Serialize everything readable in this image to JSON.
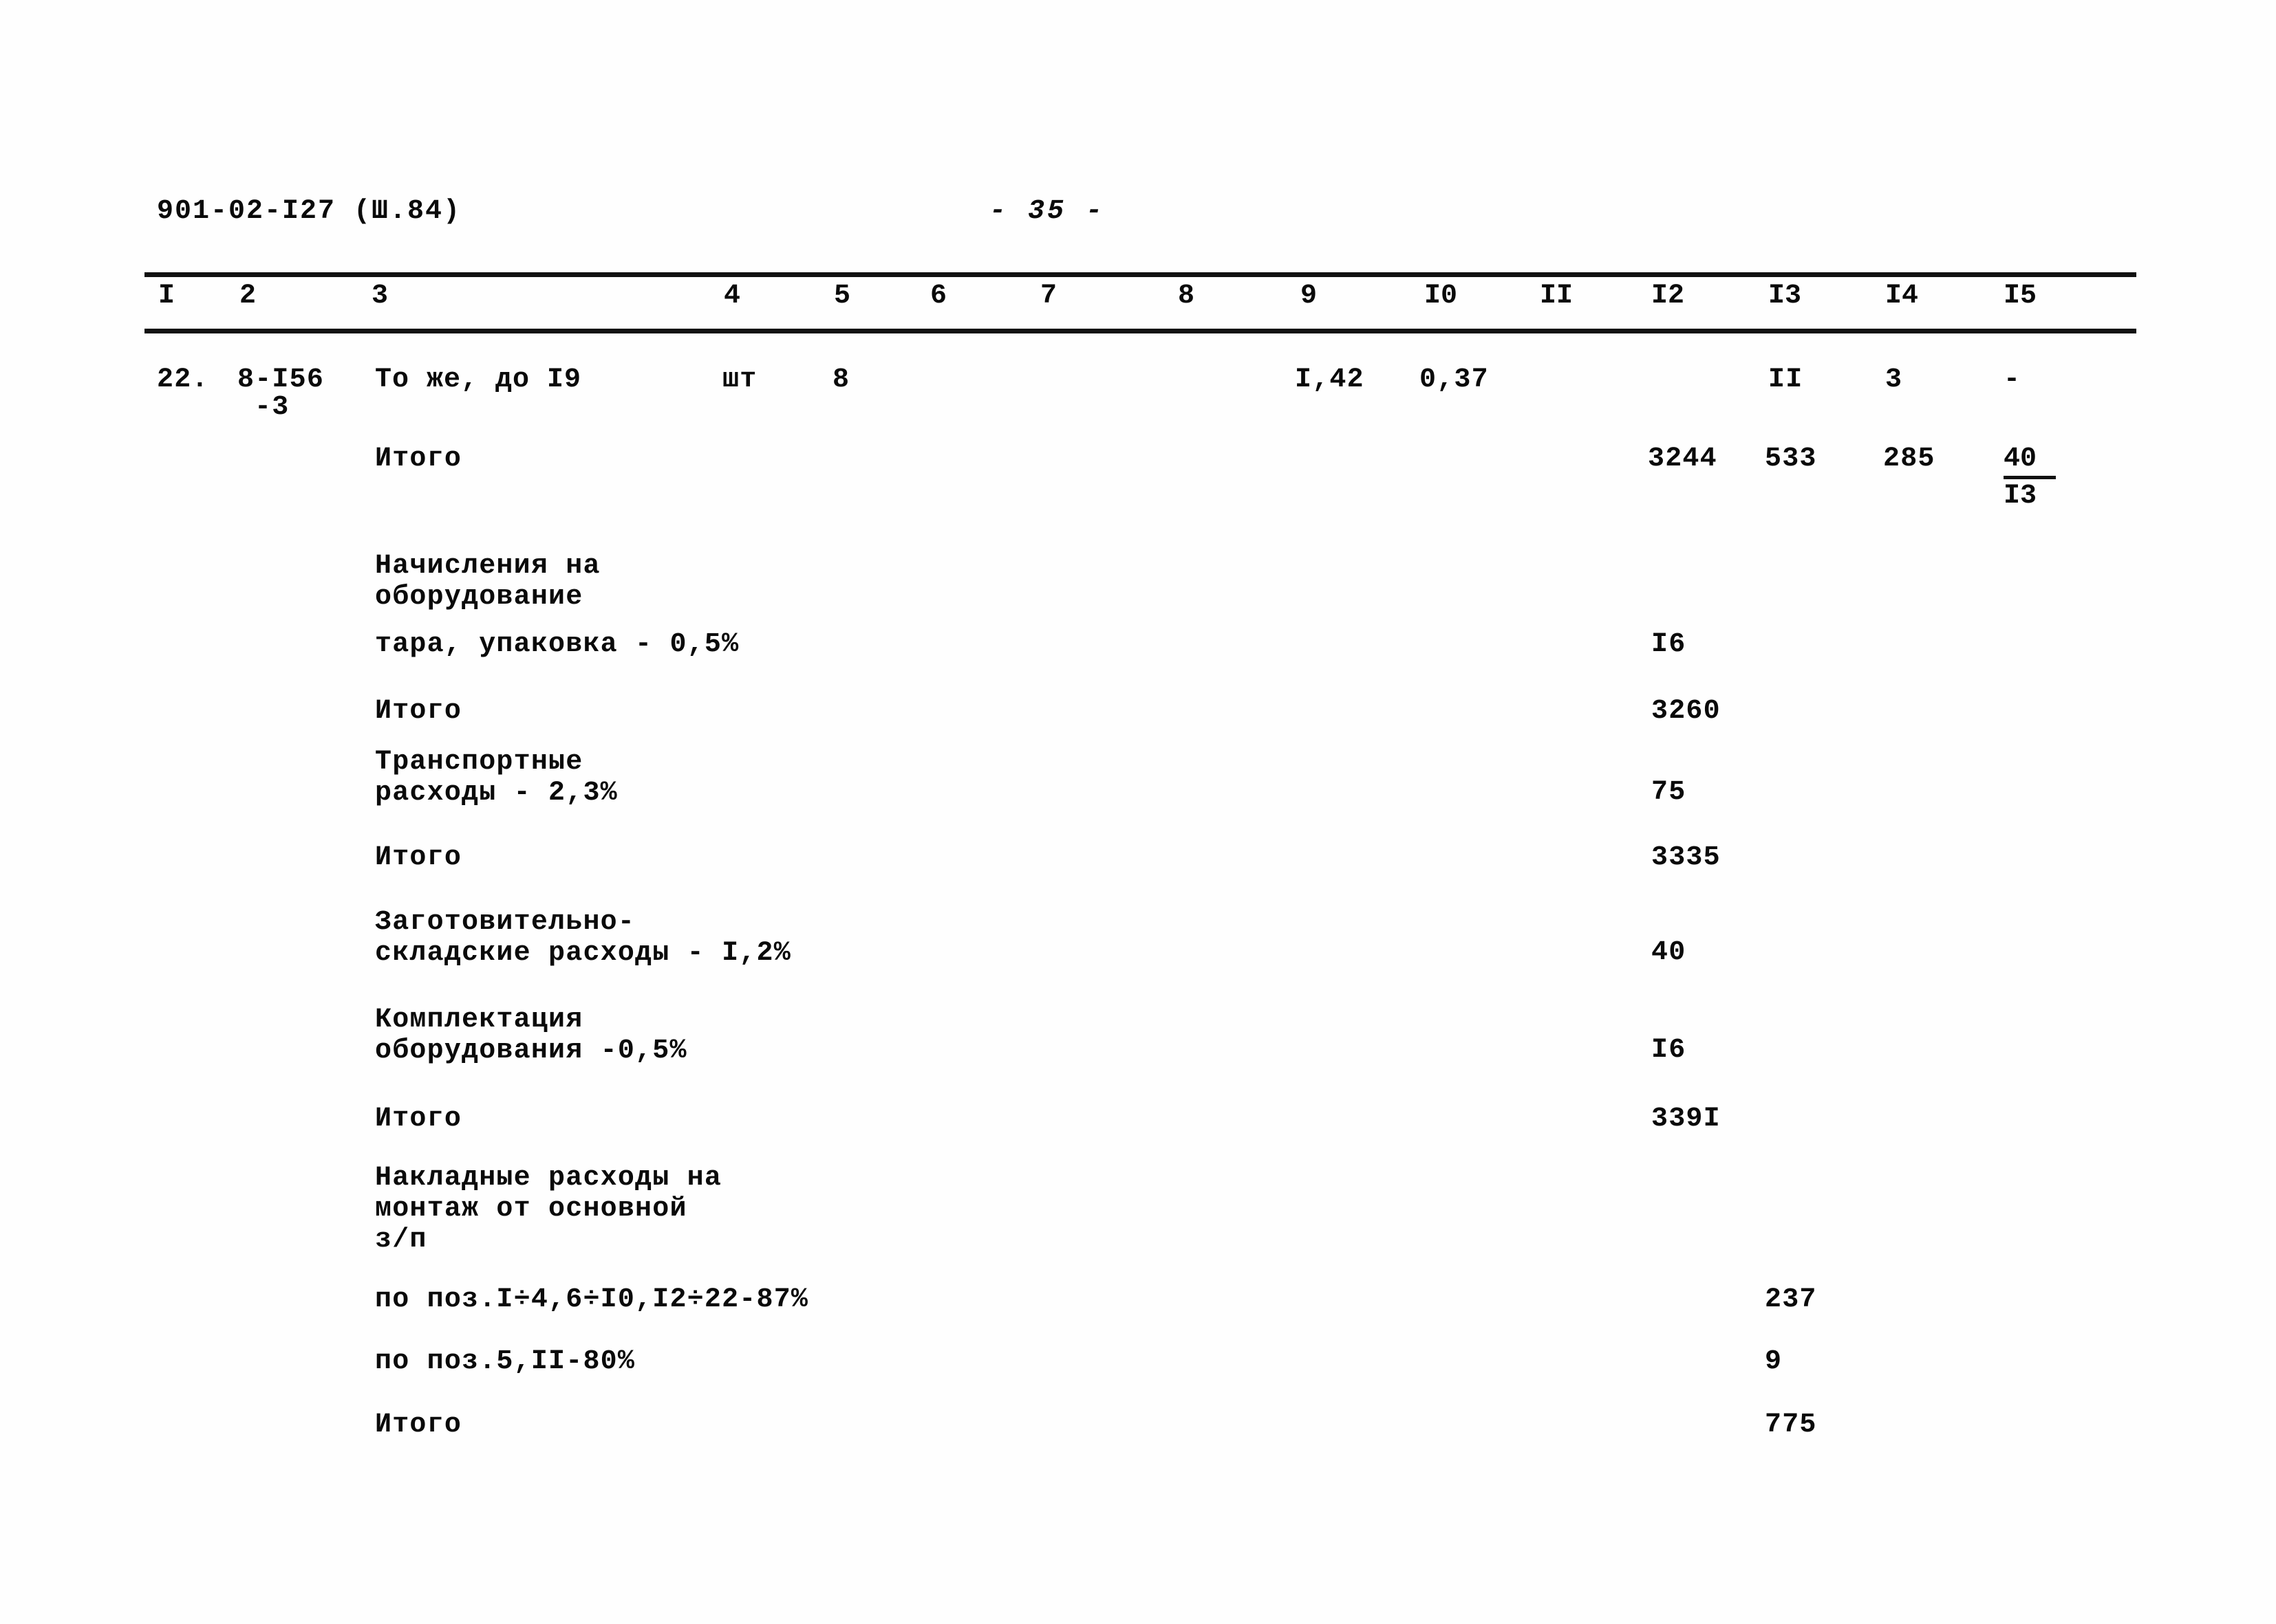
{
  "document": {
    "code": "901-02-I27 (Ш.84)",
    "page_label": "- 35 -"
  },
  "table": {
    "column_numbers": [
      "I",
      "2",
      "3",
      "4",
      "5",
      "6",
      "7",
      "8",
      "9",
      "I0",
      "II",
      "I2",
      "I3",
      "I4",
      "I5"
    ],
    "rows": [
      {
        "name": "item-row-22",
        "pos": "22.",
        "code_line1": "8-I56",
        "code_line2": "-3",
        "description": "То же, до I9",
        "unit": "шт",
        "qty": "8",
        "col9": "I,42",
        "col10": "0,37",
        "col11": "",
        "col12": "",
        "col13": "II",
        "col14": "3",
        "col15": "-"
      }
    ],
    "summary_rows": [
      {
        "name": "total-row-1",
        "label": "Итого",
        "col12": "3244",
        "col13": "533",
        "col14": "285",
        "col15_num": "40",
        "col15_den": "I3"
      },
      {
        "name": "accrual-heading",
        "label_line1": "Начисления на",
        "label_line2": "оборудование"
      },
      {
        "name": "packaging-row",
        "label": "тара, упаковка - 0,5%",
        "col12": "I6"
      },
      {
        "name": "total-row-2",
        "label": "Итого",
        "col12": "3260"
      },
      {
        "name": "transport-row",
        "label_line1": "Транспортные",
        "label_line2": "расходы - 2,3%",
        "col12": "75"
      },
      {
        "name": "total-row-3",
        "label": "Итого",
        "col12": "3335"
      },
      {
        "name": "procurement-row",
        "label_line1": "Заготовительно-",
        "label_line2": "складские расходы - I,2%",
        "col12": "40"
      },
      {
        "name": "completion-row",
        "label_line1": "Комплектация",
        "label_line2": "оборудования -0,5%",
        "col12": "I6"
      },
      {
        "name": "total-row-4",
        "label": "Итого",
        "col12": "339I"
      },
      {
        "name": "overhead-heading",
        "label_line1": "Накладные расходы на",
        "label_line2": "монтаж от основной",
        "label_line3": "з/п"
      },
      {
        "name": "overhead-pos-a",
        "label": "по поз.I÷4,6÷I0,I2÷22-87%",
        "col13": "237"
      },
      {
        "name": "overhead-pos-b",
        "label": "по поз.5,II-80%",
        "col13": "9"
      },
      {
        "name": "total-row-5",
        "label": "Итого",
        "col13": "775"
      }
    ]
  }
}
